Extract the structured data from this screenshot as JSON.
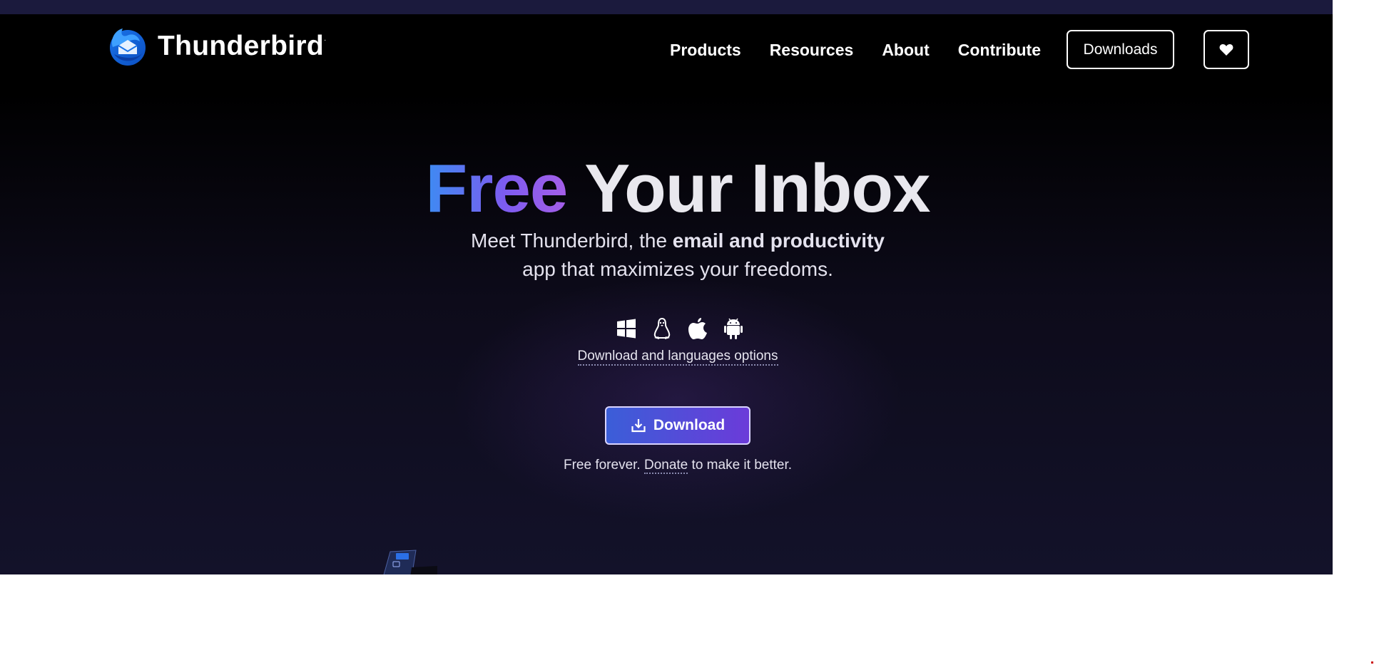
{
  "brand": {
    "name": "Thunderbird",
    "logo_icon": "thunderbird-logo-icon"
  },
  "nav": {
    "items": [
      {
        "label": "Products"
      },
      {
        "label": "Resources"
      },
      {
        "label": "About"
      },
      {
        "label": "Contribute"
      }
    ],
    "downloads_button": "Downloads",
    "donate_icon": "heart-icon"
  },
  "hero": {
    "title_highlight": "Free",
    "title_rest": "Your Inbox",
    "subtitle_part1": "Meet Thunderbird, the ",
    "subtitle_bold": "email and productivity",
    "subtitle_part2": "app that maximizes your freedoms.",
    "os_icons": [
      "windows-icon",
      "linux-icon",
      "apple-icon",
      "android-icon"
    ],
    "download_options_link": "Download and languages options",
    "download_button": "Download",
    "free_text_before": "Free forever. ",
    "donate_link": "Donate",
    "free_text_after": " to make it better."
  },
  "colors": {
    "accent_blue": "#3d8bf2",
    "accent_purple": "#a45ee8",
    "background": "#000000",
    "download_button_start": "#3b5ed8",
    "download_button_end": "#6b3bd9"
  }
}
